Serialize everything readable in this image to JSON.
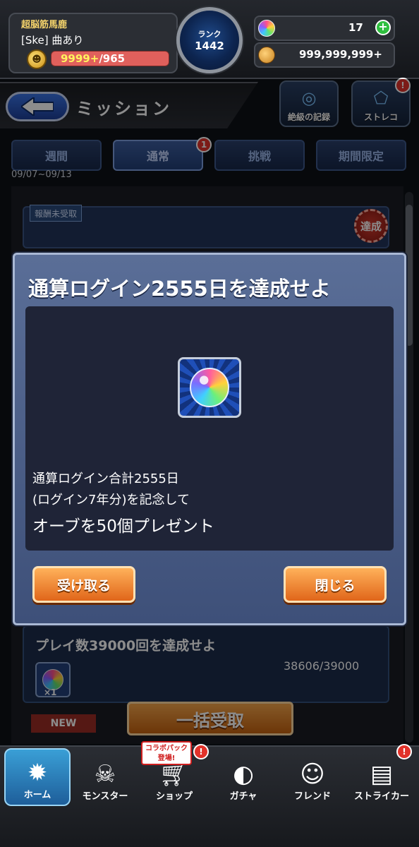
{
  "header": {
    "player_name": "超脳筋馬鹿",
    "player_tag": "[Ske] 曲あり",
    "stamina_current": "9999+",
    "stamina_max": "/965",
    "rank_label": "ランク",
    "rank_value": "1442",
    "orbs": "17",
    "gold": "999,999,999+"
  },
  "title_bar": {
    "title": "ミッション",
    "record_label": "絶級の記録",
    "strategy_label": "ストレコ"
  },
  "tabs": [
    {
      "label": "週間"
    },
    {
      "label": "通常",
      "badge": "1"
    },
    {
      "label": "挑戦"
    },
    {
      "label": "期間限定"
    }
  ],
  "tab_date": "09/07~09/13",
  "list": {
    "unclaimed_tag": "報酬未受取",
    "achieved_stamp": "達成",
    "mission2_title": "プレイ数39000回を達成せよ",
    "mission2_progress": "38606/39000",
    "mission2_count": "×1",
    "bulk_claim": "一括受取",
    "new_tag": "NEW"
  },
  "modal": {
    "title": "通算ログイン2555日を達成せよ",
    "line1": "通算ログイン合計2555日",
    "line2": "(ログイン7年分)を記念して",
    "line3": "オーブを50個プレゼント",
    "receive_button": "受け取る",
    "close_button": "閉じる"
  },
  "bottom_nav": {
    "collab_tag": "コラボパック登場!",
    "items": [
      {
        "label": "ホーム"
      },
      {
        "label": "モンスター"
      },
      {
        "label": "ショップ"
      },
      {
        "label": "ガチャ"
      },
      {
        "label": "フレンド"
      },
      {
        "label": "ストライカー"
      }
    ]
  },
  "colors": {
    "accent_orange": "#e0661a",
    "modal_blue": "#3e5079",
    "badge_red": "#e2322a"
  }
}
